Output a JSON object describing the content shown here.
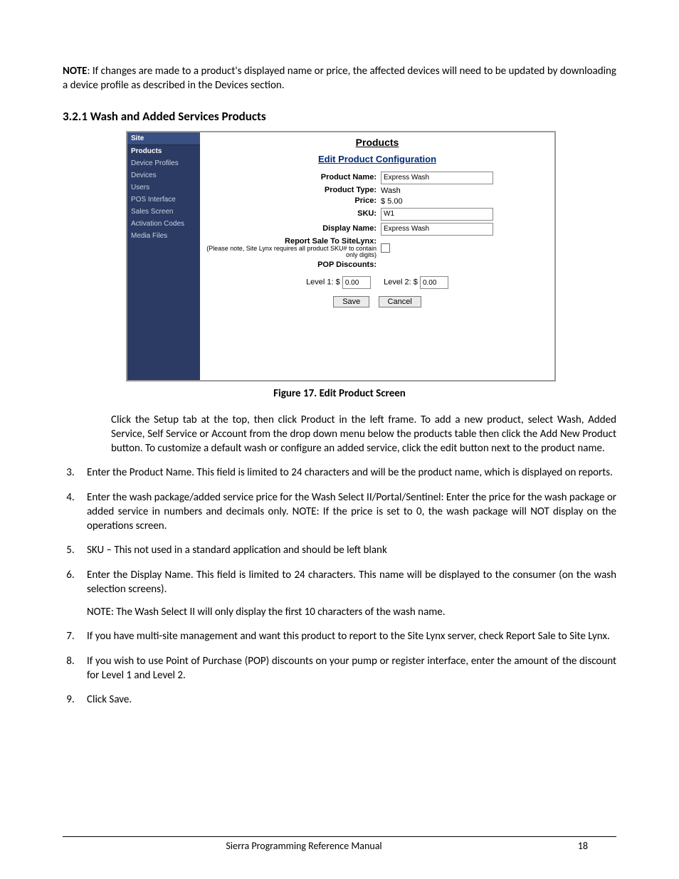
{
  "note": {
    "label": "NOTE",
    "text": ": If changes are made to a product's displayed name or price, the affected devices will need to be updated by downloading a device profile as described in the Devices section."
  },
  "heading": "3.2.1  Wash and Added Services Products",
  "screenshot": {
    "sidebar": {
      "header": "Site",
      "items": [
        "Products",
        "Device Profiles",
        "Devices",
        "Users",
        "POS Interface",
        "Sales Screen",
        "Activation Codes",
        "Media Files"
      ],
      "selected_index": 0
    },
    "title": "Products",
    "subtitle": "Edit Product Configuration",
    "fields": {
      "product_name_label": "Product Name:",
      "product_name_value": "Express Wash",
      "product_type_label": "Product Type:",
      "product_type_value": "Wash",
      "price_label": "Price:",
      "price_value": "$ 5.00",
      "sku_label": "SKU:",
      "sku_value": "W1",
      "display_name_label": "Display Name:",
      "display_name_value": "Express Wash",
      "report_label": "Report Sale To SiteLynx:",
      "report_note": "(Please note, Site Lynx requires all product SKU# to contain only digits)",
      "pop_label": "POP Discounts:",
      "level1_label": "Level 1:  $",
      "level1_value": "0.00",
      "level2_label": "Level 2:  $",
      "level2_value": "0.00",
      "save": "Save",
      "cancel": "Cancel"
    }
  },
  "caption": "Figure 17. Edit Product Screen",
  "intro_para": "Click the Setup tab at the top, then click Product in the left frame. To add a new product, select Wash, Added Service, Self Service or Account from the drop down menu below the products table then click the Add New Product button. To customize a default wash or configure an added service, click the edit button next to the product name.",
  "steps": {
    "s3": "Enter the Product Name. This field is limited to 24 characters and will be the product name, which is displayed on reports.",
    "s4": "Enter the wash package/added service price for the Wash Select II/Portal/Sentinel: Enter the price for the wash package or added service in numbers and decimals only. NOTE: If the price is set to 0, the wash package will NOT display on the operations screen.",
    "s5": "SKU – This not used in a standard application and should be left blank",
    "s6": "Enter the Display Name. This field is limited to 24 characters. This name will be displayed to the consumer (on the wash selection screens).",
    "s6_note": "NOTE: The Wash Select II will only display the first 10 characters of the wash name.",
    "s7": "If you have multi-site management and want this product to report to the Site Lynx server, check Report Sale to Site Lynx.",
    "s8": "If you wish to use Point of Purchase (POP) discounts on your pump or register interface, enter the amount of the discount for Level 1 and Level 2.",
    "s9": "Click Save."
  },
  "footer": {
    "title": "Sierra Programming Reference Manual",
    "page": "18"
  }
}
